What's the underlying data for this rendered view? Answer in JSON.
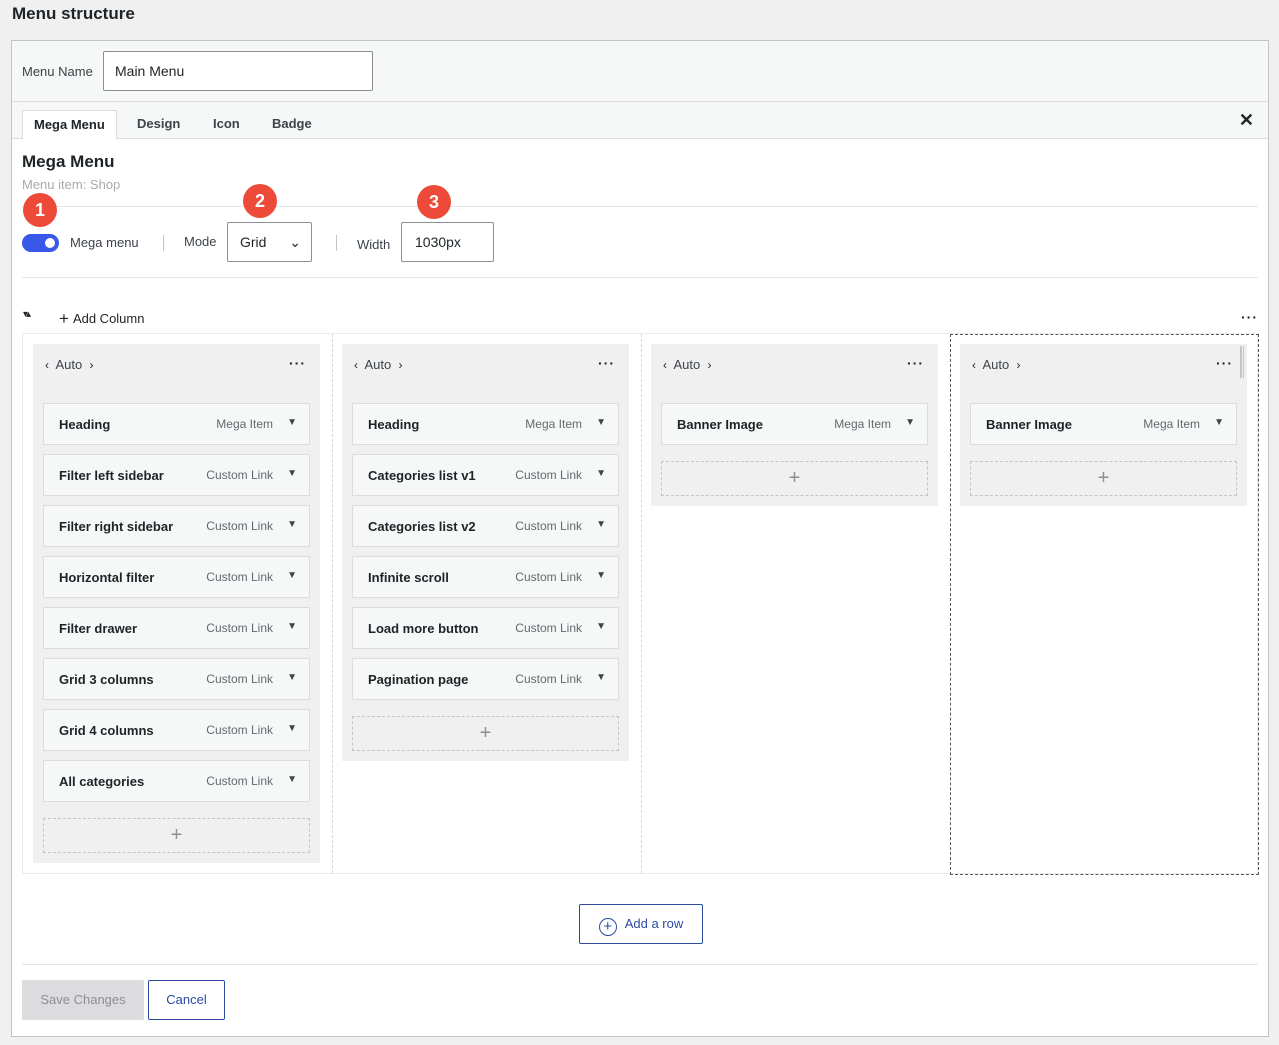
{
  "page": {
    "title": "Menu structure"
  },
  "menu_name": {
    "label": "Menu Name",
    "value": "Main Menu"
  },
  "tabs": [
    {
      "label": "Mega Menu",
      "active": true
    },
    {
      "label": "Design",
      "active": false
    },
    {
      "label": "Icon",
      "active": false
    },
    {
      "label": "Badge",
      "active": false
    }
  ],
  "close_icon": "close-icon",
  "panel": {
    "title": "Mega Menu",
    "subtitle": "Menu item: Shop"
  },
  "settings": {
    "mega_menu_label": "Mega menu",
    "mega_menu_enabled": true,
    "mode_label": "Mode",
    "mode_value": "Grid",
    "width_label": "Width",
    "width_value": "1030px"
  },
  "markers": [
    "1",
    "2",
    "3"
  ],
  "toolbar": {
    "add_column": "Add Column"
  },
  "columns": [
    {
      "width_label": "Auto",
      "items": [
        {
          "title": "Heading",
          "type": "Mega Item"
        },
        {
          "title": "Filter left sidebar",
          "type": "Custom Link"
        },
        {
          "title": "Filter right sidebar",
          "type": "Custom Link"
        },
        {
          "title": "Horizontal filter",
          "type": "Custom Link"
        },
        {
          "title": "Filter drawer",
          "type": "Custom Link"
        },
        {
          "title": "Grid 3 columns",
          "type": "Custom Link"
        },
        {
          "title": "Grid 4 columns",
          "type": "Custom Link"
        },
        {
          "title": "All categories",
          "type": "Custom Link"
        }
      ]
    },
    {
      "width_label": "Auto",
      "items": [
        {
          "title": "Heading",
          "type": "Mega Item"
        },
        {
          "title": "Categories list v1",
          "type": "Custom Link"
        },
        {
          "title": "Categories list v2",
          "type": "Custom Link"
        },
        {
          "title": "Infinite scroll",
          "type": "Custom Link"
        },
        {
          "title": "Load more button",
          "type": "Custom Link"
        },
        {
          "title": "Pagination page",
          "type": "Custom Link"
        }
      ]
    },
    {
      "width_label": "Auto",
      "items": [
        {
          "title": "Banner Image",
          "type": "Mega Item"
        }
      ]
    },
    {
      "width_label": "Auto",
      "items": [
        {
          "title": "Banner Image",
          "type": "Mega Item"
        }
      ]
    }
  ],
  "footer": {
    "add_row": "Add a row",
    "save": "Save Changes",
    "cancel": "Cancel"
  },
  "colors": {
    "accent": "#3858e9",
    "button_blue": "#2c4ba0",
    "marker_red": "#ee4a3a"
  }
}
